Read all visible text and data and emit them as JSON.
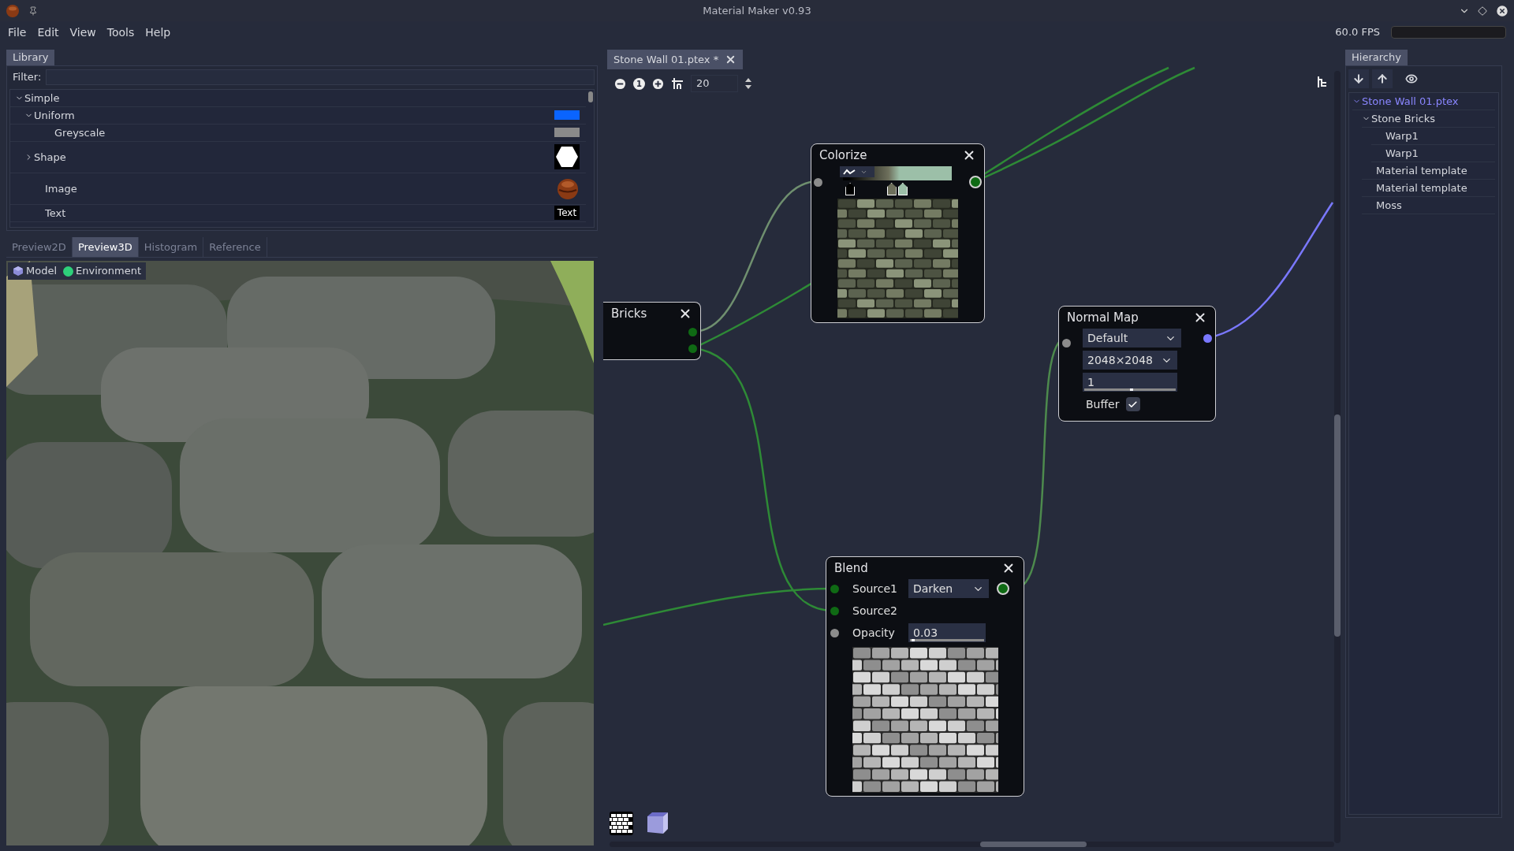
{
  "window": {
    "title": "Material Maker v0.93"
  },
  "menu": [
    "File",
    "Edit",
    "View",
    "Tools",
    "Help"
  ],
  "fps": "60.0 FPS",
  "library": {
    "tab": "Library",
    "filter_label": "Filter:",
    "items": [
      {
        "label": "Simple",
        "expanded": true,
        "children": [
          {
            "label": "Uniform",
            "expanded": true,
            "thumb": {
              "kind": "swatch",
              "color": "#0a64ff"
            },
            "children": [
              {
                "label": "Greyscale",
                "thumb": {
                  "kind": "swatch",
                  "color": "#8a8a8a"
                }
              }
            ]
          },
          {
            "label": "Shape",
            "expanded": false,
            "thumb": {
              "kind": "hexagon"
            }
          },
          {
            "label": "Image"
          },
          {
            "label": "Text",
            "thumb": {
              "kind": "text",
              "text": "Text"
            }
          }
        ]
      }
    ]
  },
  "preview": {
    "tabs": [
      {
        "label": "Preview2D",
        "selected": false
      },
      {
        "label": "Preview3D",
        "selected": true
      },
      {
        "label": "Histogram",
        "selected": false
      },
      {
        "label": "Reference",
        "selected": false
      }
    ],
    "toolbar": [
      {
        "kind": "model",
        "label": "Model"
      },
      {
        "kind": "environment",
        "label": "Environment"
      }
    ]
  },
  "graph": {
    "tab": {
      "label": "Stone Wall 01.ptex *"
    },
    "toolbar": {
      "reset_label": "1",
      "zoom_value": "20"
    },
    "nodes": [
      {
        "kind": "bricks",
        "title": "Bricks",
        "outputs": [
          {
            "color": "#0f6a14",
            "kind": "dot"
          },
          {
            "color": "#0f6a14",
            "kind": "dot"
          }
        ]
      },
      {
        "kind": "colorize",
        "title": "Colorize",
        "inputs": [
          {
            "color": "#8c8c8c"
          }
        ],
        "outputs": [
          {
            "color": "#0f6a14",
            "kind": "ring"
          }
        ],
        "gradient": [
          {
            "color": "#000000"
          },
          {
            "color": "#6e705c"
          },
          {
            "color": "#9cbfa8"
          }
        ]
      },
      {
        "kind": "normal_map",
        "title": "Normal Map",
        "inputs": [
          {
            "color": "#8c8c8c"
          }
        ],
        "outputs": [
          {
            "color": "#7a78ff",
            "kind": "dot"
          }
        ],
        "controls": [
          {
            "kind": "dropdown",
            "value": "Default"
          },
          {
            "kind": "dropdown",
            "value": "2048×2048"
          },
          {
            "kind": "slider",
            "value": "1",
            "level": 0.5
          },
          {
            "kind": "checkbox",
            "label": "Buffer",
            "checked": true
          }
        ]
      },
      {
        "kind": "blend",
        "title": "Blend",
        "outputs": [
          {
            "color": "#0f6a14",
            "kind": "ring"
          }
        ],
        "rows": [
          {
            "kind": "dropdown",
            "label": "Source1",
            "port": {
              "color": "#0f6a14"
            },
            "value": "Darken"
          },
          {
            "kind": "plain",
            "label": "Source2",
            "port": {
              "color": "#0f6a14"
            }
          },
          {
            "kind": "slider",
            "label": "Opacity",
            "port": {
              "color": "#8c8c8c"
            },
            "value": "0.03",
            "level": 0.02
          }
        ]
      }
    ]
  },
  "hierarchy": {
    "tab": "Hierarchy",
    "items": [
      {
        "label": "Stone Wall 01.ptex",
        "selected": true,
        "expanded": true,
        "children": [
          {
            "label": "Stone Bricks",
            "selected": false,
            "expanded": true,
            "children": [
              {
                "label": "Warp1",
                "selected": false
              },
              {
                "label": "Warp1",
                "selected": false
              }
            ]
          },
          {
            "label": "Material template",
            "selected": false
          },
          {
            "label": "Material template",
            "selected": false
          },
          {
            "label": "Moss",
            "selected": false
          }
        ]
      }
    ]
  }
}
